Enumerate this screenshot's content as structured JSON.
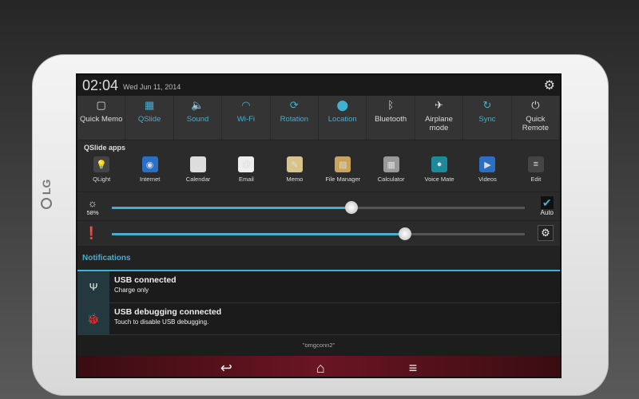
{
  "status": {
    "time": "02:04",
    "date": "Wed Jun 11, 2014"
  },
  "tiles": [
    {
      "label": "Quick Memo",
      "icon": "▢",
      "on": false
    },
    {
      "label": "QSlide",
      "icon": "▦",
      "on": true
    },
    {
      "label": "Sound",
      "icon": "🔈",
      "on": true
    },
    {
      "label": "Wi-Fi",
      "icon": "◠",
      "on": true
    },
    {
      "label": "Rotation",
      "icon": "⟳",
      "on": true
    },
    {
      "label": "Location",
      "icon": "⬤",
      "on": true
    },
    {
      "label": "Bluetooth",
      "icon": "ᛒ",
      "on": false
    },
    {
      "label": "Airplane mode",
      "icon": "✈",
      "on": false
    },
    {
      "label": "Sync",
      "icon": "↻",
      "on": true
    },
    {
      "label": "Quick Remote",
      "icon": "⏻",
      "on": false
    }
  ],
  "qslide_label": "QSlide apps",
  "apps": [
    {
      "label": "QLight",
      "icon": "💡",
      "color": "#444"
    },
    {
      "label": "Internet",
      "icon": "◉",
      "color": "#2a6fc4"
    },
    {
      "label": "Calendar",
      "icon": "▦",
      "color": "#ddd"
    },
    {
      "label": "Email",
      "icon": "@",
      "color": "#eee"
    },
    {
      "label": "Memo",
      "icon": "✎",
      "color": "#d8c48a"
    },
    {
      "label": "File Manager",
      "icon": "▤",
      "color": "#c9a35a"
    },
    {
      "label": "Calculator",
      "icon": "▦",
      "color": "#999"
    },
    {
      "label": "Voice Mate",
      "icon": "●",
      "color": "#1c8a9a"
    },
    {
      "label": "Videos",
      "icon": "▶",
      "color": "#2a6fc4"
    },
    {
      "label": "Edit",
      "icon": "≡",
      "color": "#444"
    }
  ],
  "brightness": {
    "percent": "58%",
    "value": 58,
    "auto_label": "Auto"
  },
  "volume": {
    "value": 71
  },
  "notifications": {
    "header": "Notifications",
    "items": [
      {
        "title": "USB connected",
        "subtitle": "Charge only",
        "icon": "Ψ"
      },
      {
        "title": "USB debugging connected",
        "subtitle": "Touch to disable USB debugging.",
        "icon": "🐞"
      }
    ]
  },
  "carrier": "\"omgconn2\"",
  "brand": "LG"
}
